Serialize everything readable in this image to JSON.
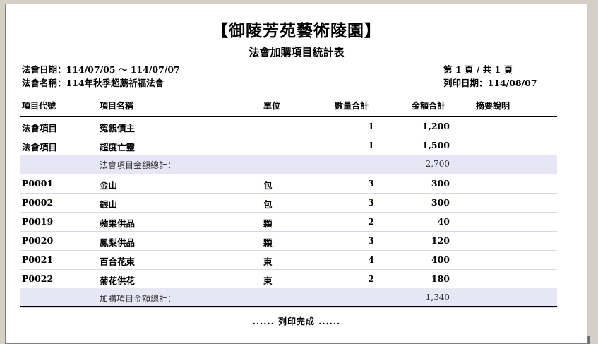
{
  "report": {
    "title": "【御陵芳苑藝術陵園】",
    "subtitle": "法會加購項目統計表",
    "date_range": "法會日期：114/07/05 ～ 114/07/07",
    "ceremony_name": "法會名稱：114年秋季超薦祈福法會",
    "page_info": "第 1 頁 / 共 1 頁",
    "print_date": "列印日期：114/08/07",
    "end_text": "...... 列印完成 ......"
  },
  "table": {
    "headers": [
      "項目代號",
      "項目名稱",
      "單位",
      "數量合計",
      "金額合計",
      "摘要說明"
    ],
    "rows": [
      {
        "code": "法會項目",
        "name": "冤親債主",
        "unit": "",
        "qty": "1",
        "amount": "1,200"
      },
      {
        "code": "法會項目",
        "name": "超度亡靈",
        "unit": "",
        "qty": "1",
        "amount": "1,500"
      },
      {
        "subtotal": true,
        "label": "法會項目金額總計：",
        "amount": "2,700"
      },
      {
        "code": "P0001",
        "name": "金山",
        "unit": "包",
        "qty": "3",
        "amount": "300"
      },
      {
        "code": "P0002",
        "name": "銀山",
        "unit": "包",
        "qty": "3",
        "amount": "300"
      },
      {
        "code": "P0019",
        "name": "蘋果供品",
        "unit": "顆",
        "qty": "2",
        "amount": "40"
      },
      {
        "code": "P0020",
        "name": "鳳梨供品",
        "unit": "顆",
        "qty": "3",
        "amount": "120"
      },
      {
        "code": "P0021",
        "name": "百合花束",
        "unit": "束",
        "qty": "4",
        "amount": "400"
      },
      {
        "code": "P0022",
        "name": "菊花供花",
        "unit": "束",
        "qty": "2",
        "amount": "180"
      },
      {
        "subtotal": true,
        "label": "加購項目金額總計：",
        "amount": "1,340"
      }
    ]
  }
}
